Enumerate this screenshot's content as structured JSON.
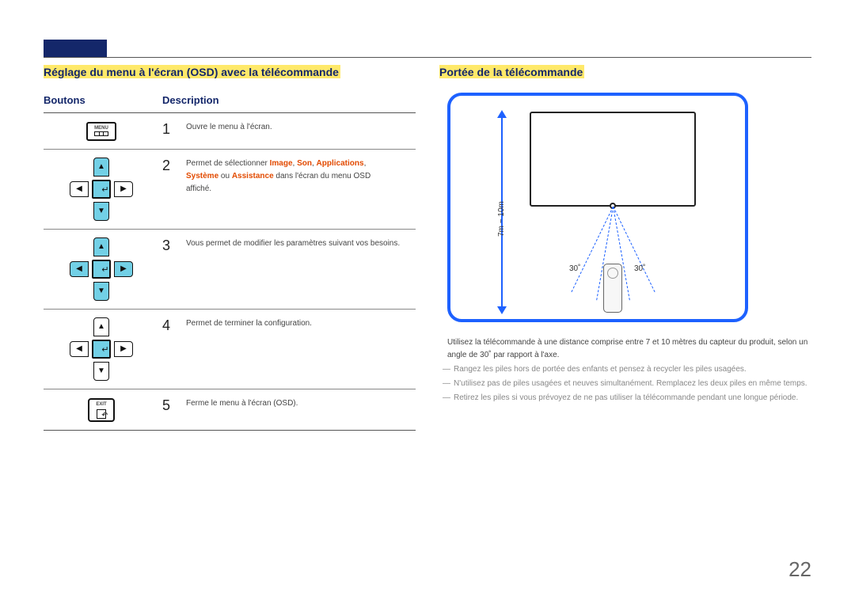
{
  "page_number": "22",
  "left": {
    "title": "Réglage du menu à l'écran (OSD) avec la télécommande",
    "col1_header": "Boutons",
    "col2_header": "Description",
    "menu_chip_label": "MENU",
    "exit_chip_label": "EXIT",
    "rows": [
      {
        "num": "1",
        "desc_plain": "Ouvre le menu à l'écran."
      },
      {
        "num": "2",
        "p1_a": "Permet de sélectionner ",
        "p1_b": "Image",
        "p1_c": ", ",
        "p1_d": "Son",
        "p1_e": ", ",
        "p1_f": "Applications",
        "p1_g": ",",
        "p2_a": "Système",
        "p2_b": " ou ",
        "p2_c": "Assistance",
        "p2_d": " dans l'écran du menu OSD",
        "p3": "affiché."
      },
      {
        "num": "3",
        "desc_plain": "Vous permet de modifier les paramètres suivant vos besoins."
      },
      {
        "num": "4",
        "desc_plain": "Permet de terminer la configuration."
      },
      {
        "num": "5",
        "desc_plain": "Ferme le menu à l'écran (OSD)."
      }
    ]
  },
  "right": {
    "title": "Portée de la télécommande",
    "distance_label": "7m ~ 10m",
    "angle_left": "30˚",
    "angle_right": "30˚",
    "usage_note": "Utilisez la télécommande à une distance comprise entre 7 et 10 mètres du capteur du produit, selon un angle de 30˚ par rapport à l'axe.",
    "bullets": [
      "Rangez les piles hors de portée des enfants et pensez à recycler les piles usagées.",
      "N'utilisez pas de piles usagées et neuves simultanément. Remplacez les deux piles en même temps.",
      "Retirez les piles si vous prévoyez de ne pas utiliser la télécommande pendant une longue période."
    ]
  }
}
